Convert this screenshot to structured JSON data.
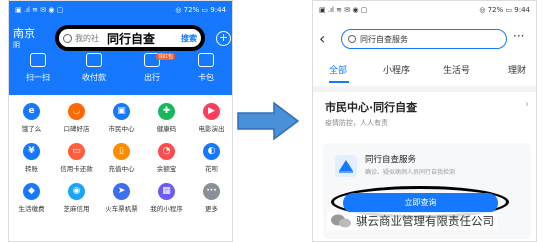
{
  "left_screen": {
    "status": {
      "left": "▣ .ıl ≋ ✉ ◉ ▢",
      "right": "◎ 72% ▭ 9:44"
    },
    "city": "南京",
    "city_sub": "阴",
    "search": {
      "placeholder": "我的社",
      "query": "同行自查",
      "button": "搜索"
    },
    "plus_icon": "+",
    "quick_actions": [
      {
        "label": "扫一扫"
      },
      {
        "label": "收付款"
      },
      {
        "label": "出行"
      },
      {
        "label": "卡包"
      }
    ],
    "quick_badge": "领红包",
    "grid": [
      {
        "label": "饿了么",
        "glyph": "e",
        "color": "#1677ff"
      },
      {
        "label": "口碑好店",
        "glyph": "◡",
        "color": "#ff6a00"
      },
      {
        "label": "市民中心",
        "glyph": "▣",
        "color": "#1677ff"
      },
      {
        "label": "健康码",
        "glyph": "✚",
        "color": "#15b85a"
      },
      {
        "label": "电影演出",
        "glyph": "▶",
        "color": "#ff3d5b"
      },
      {
        "label": "转账",
        "glyph": "¥",
        "color": "#1677ff"
      },
      {
        "label": "信用卡还款",
        "glyph": "▭",
        "color": "#ff5f3d"
      },
      {
        "label": "充值中心",
        "glyph": "▯",
        "color": "#ff8b00"
      },
      {
        "label": "余额宝",
        "glyph": "◔",
        "color": "#ff4d4f"
      },
      {
        "label": "花呗",
        "glyph": "◐",
        "color": "#1677ff"
      },
      {
        "label": "生活缴费",
        "glyph": "◆",
        "color": "#1677ff"
      },
      {
        "label": "芝麻信用",
        "glyph": "◉",
        "color": "#1aa4ff"
      },
      {
        "label": "火车票机票",
        "glyph": "➤",
        "color": "#3a6ff2"
      },
      {
        "label": "我的小程序",
        "glyph": "▦",
        "color": "#6a5cf5"
      },
      {
        "label": "更多",
        "glyph": "···",
        "color": "#8a8f99"
      }
    ]
  },
  "right_screen": {
    "status": {
      "left": "▣ .ıl ≋ ✉ ◉ ▢",
      "right": "◎ 72% ▭ 9:44"
    },
    "back_icon": "‹",
    "search_value": "同行自查服务",
    "more_icon": "···",
    "tabs": [
      {
        "label": "全部",
        "active": true
      },
      {
        "label": "小程序",
        "active": false
      },
      {
        "label": "生活号",
        "active": false
      },
      {
        "label": "理财",
        "active": false
      }
    ],
    "section_title": "市民中心·同行自查",
    "section_subtitle": "疫情防控，人人有责",
    "chevron_icon": "›",
    "card": {
      "title": "同行自查服务",
      "desc": "确诊、疑似病例人员同行自我检测",
      "button": "立即查询"
    }
  },
  "watermark": "骐云商业管理有限责任公司",
  "colors": {
    "accent": "#1677ff",
    "highlight_outline": "#000000"
  }
}
